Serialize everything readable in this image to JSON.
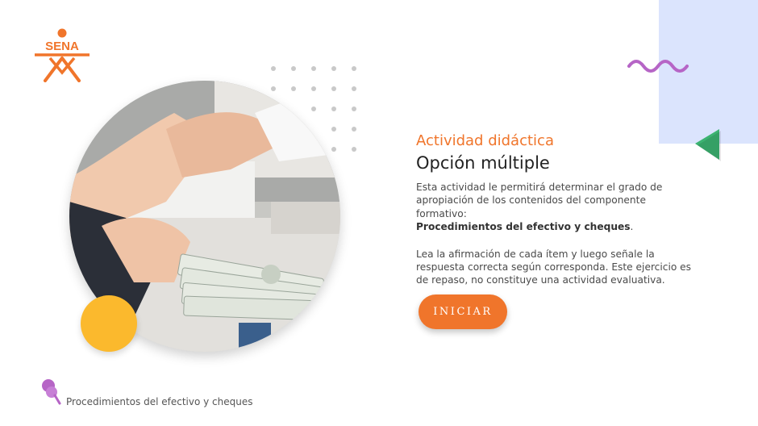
{
  "brand": {
    "logo_text": "SENA",
    "accent_orange": "#f0752b",
    "purple": "#b665c6",
    "green": "#3cb371",
    "yellow": "#fbb92d",
    "light_blue": "#dbe4fd"
  },
  "activity": {
    "kicker": "Actividad didáctica",
    "title": "Opción múltiple",
    "intro_text": "Esta actividad le permitirá determinar el grado de apropiación de los contenidos del componente formativo:",
    "intro_bold": "Procedimientos del efectivo y cheques",
    "intro_end": ".",
    "instructions": "Lea la afirmación de cada ítem y luego señale la respuesta correcta según corresponda.  Este ejercicio es de repaso, no constituye una actividad evaluativa."
  },
  "buttons": {
    "start_label": "INICIAR"
  },
  "footer": {
    "label": "Procedimientos del efectivo y cheques",
    "icon": "thumbtack-icon"
  },
  "image": {
    "subject": "handshake-with-money-photo"
  }
}
